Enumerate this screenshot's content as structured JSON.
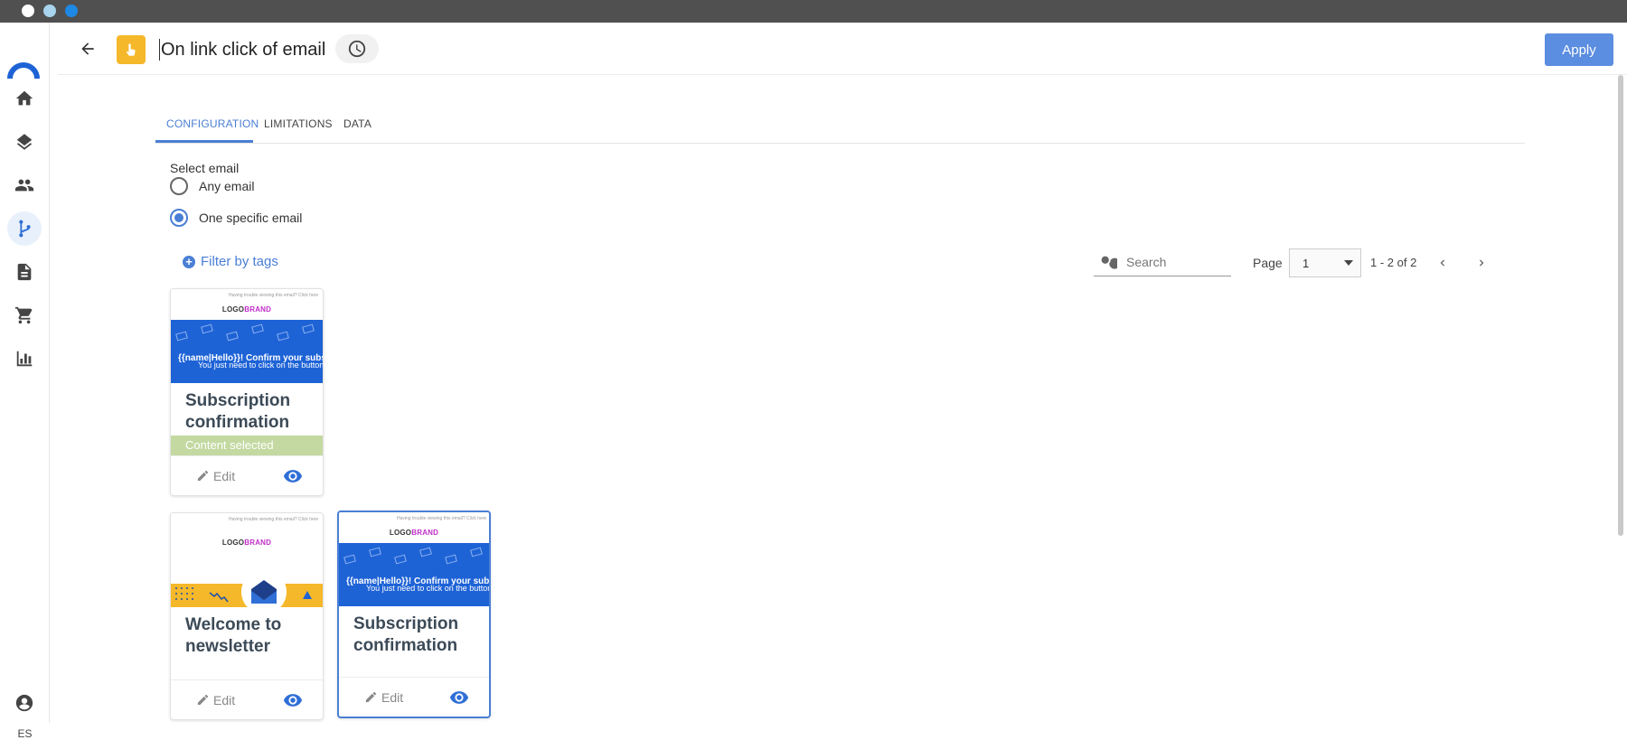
{
  "window": {
    "colors": {
      "titlebar": "#505050",
      "dot1": "#ffffff",
      "dot2": "#a8d4ee",
      "dot3": "#1e88e5"
    }
  },
  "sidebar": {
    "items": [
      {
        "icon": "home-icon"
      },
      {
        "icon": "layers-icon"
      },
      {
        "icon": "people-icon"
      },
      {
        "icon": "workflow-icon",
        "active": true
      },
      {
        "icon": "document-icon"
      },
      {
        "icon": "cart-icon"
      },
      {
        "icon": "bar-chart-icon"
      }
    ],
    "language": "ES"
  },
  "header": {
    "title": "On link click of email",
    "apply_label": "Apply",
    "trigger_icon": "pointer-click-icon",
    "history_icon": "clock-icon"
  },
  "tabs": [
    {
      "label": "CONFIGURATION",
      "active": true
    },
    {
      "label": "LIMITATIONS"
    },
    {
      "label": "DATA"
    }
  ],
  "config": {
    "select_label": "Select email",
    "options": [
      {
        "label": "Any email",
        "checked": false
      },
      {
        "label": "One specific email",
        "checked": true
      }
    ],
    "filter_label": "Filter by tags"
  },
  "list_controls": {
    "search_placeholder": "Search",
    "page_label": "Page",
    "page_value": "1",
    "range": "1 - 2 of 2"
  },
  "cards": [
    {
      "title": "Subscription confirmation",
      "badge": "Content selected",
      "edit_label": "Edit",
      "thumb": {
        "preheader": "Having trouble viewing this email? Click here",
        "brand_logo": "LOGO",
        "brand_accent": "BRAND",
        "headline": "{{name|Hello}}! Confirm your subscription",
        "subline": "You just need to click on the button below"
      }
    },
    {
      "title": "Welcome to newsletter",
      "edit_label": "Edit",
      "thumb": {
        "preheader": "Having trouble viewing this email? Click here",
        "brand_logo": "LOGO",
        "brand_accent": "BRAND"
      }
    },
    {
      "title": "Subscription confirmation",
      "edit_label": "Edit",
      "thumb": {
        "preheader": "Having trouble viewing this email? Click here",
        "brand_logo": "LOGO",
        "brand_accent": "BRAND",
        "headline": "{{name|Hello}}! Confirm your subscription",
        "subline": "You just need to click on the button below"
      }
    }
  ]
}
